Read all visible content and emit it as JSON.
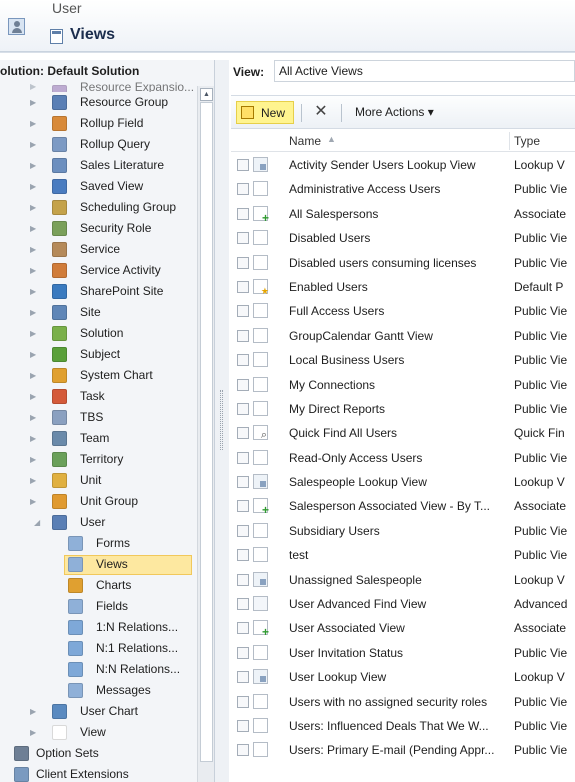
{
  "header": {
    "subtitle": "User",
    "title": "Views"
  },
  "left_panel": {
    "solution_label": "olution: Default Solution",
    "tree": [
      {
        "label": "Resource Expansio...",
        "icon": "resource-expansion-icon",
        "color": "#9a7bb8"
      },
      {
        "label": "Resource Group",
        "icon": "resource-group-icon",
        "color": "#5a7fb5"
      },
      {
        "label": "Rollup Field",
        "icon": "rollup-field-icon",
        "color": "#d88a3a"
      },
      {
        "label": "Rollup Query",
        "icon": "rollup-query-icon",
        "color": "#7c9ac4"
      },
      {
        "label": "Sales Literature",
        "icon": "sales-literature-icon",
        "color": "#6c8fbf"
      },
      {
        "label": "Saved View",
        "icon": "saved-view-icon",
        "color": "#4a7cc0"
      },
      {
        "label": "Scheduling Group",
        "icon": "scheduling-group-icon",
        "color": "#c4a24a"
      },
      {
        "label": "Security Role",
        "icon": "security-role-icon",
        "color": "#7aa05a"
      },
      {
        "label": "Service",
        "icon": "service-icon",
        "color": "#b58a5a"
      },
      {
        "label": "Service Activity",
        "icon": "service-activity-icon",
        "color": "#d07c3a"
      },
      {
        "label": "SharePoint Site",
        "icon": "sharepoint-site-icon",
        "color": "#3a7abf"
      },
      {
        "label": "Site",
        "icon": "site-icon",
        "color": "#5f86b7"
      },
      {
        "label": "Solution",
        "icon": "solution-icon",
        "color": "#7ab04a"
      },
      {
        "label": "Subject",
        "icon": "subject-icon",
        "color": "#5aa03a"
      },
      {
        "label": "System Chart",
        "icon": "system-chart-icon",
        "color": "#e0a030"
      },
      {
        "label": "Task",
        "icon": "task-icon",
        "color": "#d45a3a"
      },
      {
        "label": "TBS",
        "icon": "tbs-icon",
        "color": "#8aa0c0"
      },
      {
        "label": "Team",
        "icon": "team-icon",
        "color": "#6a8aaa"
      },
      {
        "label": "Territory",
        "icon": "territory-icon",
        "color": "#6aa05a"
      },
      {
        "label": "Unit",
        "icon": "unit-icon",
        "color": "#e0b040"
      },
      {
        "label": "Unit Group",
        "icon": "unit-group-icon",
        "color": "#e09a30"
      }
    ],
    "user_node": {
      "label": "User",
      "icon": "user-icon",
      "color": "#5a7fb5"
    },
    "user_children": [
      {
        "label": "Forms",
        "icon": "forms-icon",
        "color": "#8fb0d8",
        "selected": false
      },
      {
        "label": "Views",
        "icon": "views-icon",
        "color": "#8fb0d8",
        "selected": true
      },
      {
        "label": "Charts",
        "icon": "charts-icon",
        "color": "#e0a030",
        "selected": false
      },
      {
        "label": "Fields",
        "icon": "fields-icon",
        "color": "#8fb0d8",
        "selected": false
      },
      {
        "label": "1:N Relations...",
        "icon": "one-to-many-icon",
        "color": "#7ea8d8",
        "selected": false
      },
      {
        "label": "N:1 Relations...",
        "icon": "many-to-one-icon",
        "color": "#7ea8d8",
        "selected": false
      },
      {
        "label": "N:N Relations...",
        "icon": "many-to-many-icon",
        "color": "#7ea8d8",
        "selected": false
      },
      {
        "label": "Messages",
        "icon": "messages-icon",
        "color": "#8fb0d8",
        "selected": false
      }
    ],
    "after_user": [
      {
        "label": "User Chart",
        "icon": "user-chart-icon",
        "color": "#5a8ac0"
      },
      {
        "label": "View",
        "icon": "view-icon",
        "color": "#ffffff"
      }
    ],
    "bottom_items": [
      {
        "label": "Option Sets",
        "icon": "option-sets-icon",
        "color": "#6e7f95"
      },
      {
        "label": "Client Extensions",
        "icon": "client-extensions-icon",
        "color": "#7a9ac0"
      }
    ]
  },
  "view_selector": {
    "label": "View:",
    "value": "All Active Views"
  },
  "toolbar": {
    "new_label": "New",
    "delete_glyph": "✕",
    "more_actions_label": "More Actions ▾"
  },
  "grid": {
    "columns": {
      "name": "Name",
      "type": "Type"
    },
    "rows": [
      {
        "name": "Activity Sender Users Lookup View",
        "type": "Lookup V",
        "icon": "lookup"
      },
      {
        "name": "Administrative Access Users",
        "type": "Public Vie",
        "icon": "public"
      },
      {
        "name": "All Salespersons",
        "type": "Associate",
        "icon": "assoc"
      },
      {
        "name": "Disabled Users",
        "type": "Public Vie",
        "icon": "public"
      },
      {
        "name": "Disabled users consuming licenses",
        "type": "Public Vie",
        "icon": "public"
      },
      {
        "name": "Enabled Users",
        "type": "Default P",
        "icon": "deflt"
      },
      {
        "name": "Full Access Users",
        "type": "Public Vie",
        "icon": "public"
      },
      {
        "name": "GroupCalendar Gantt View",
        "type": "Public Vie",
        "icon": "public"
      },
      {
        "name": "Local Business Users",
        "type": "Public Vie",
        "icon": "public"
      },
      {
        "name": "My Connections",
        "type": "Public Vie",
        "icon": "public"
      },
      {
        "name": "My Direct Reports",
        "type": "Public Vie",
        "icon": "public"
      },
      {
        "name": "Quick Find All Users",
        "type": "Quick Fin",
        "icon": "quick"
      },
      {
        "name": "Read-Only Access Users",
        "type": "Public Vie",
        "icon": "public"
      },
      {
        "name": "Salespeople Lookup View",
        "type": "Lookup V",
        "icon": "lookup"
      },
      {
        "name": "Salesperson Associated View - By T...",
        "type": "Associate",
        "icon": "assoc"
      },
      {
        "name": "Subsidiary Users",
        "type": "Public Vie",
        "icon": "public"
      },
      {
        "name": "test",
        "type": "Public Vie",
        "icon": "public"
      },
      {
        "name": "Unassigned Salespeople",
        "type": "Lookup V",
        "icon": "lookup"
      },
      {
        "name": "User Advanced Find View",
        "type": "Advanced",
        "icon": "adv"
      },
      {
        "name": "User Associated View",
        "type": "Associate",
        "icon": "assoc"
      },
      {
        "name": "User Invitation Status",
        "type": "Public Vie",
        "icon": "public"
      },
      {
        "name": "User Lookup View",
        "type": "Lookup V",
        "icon": "lookup"
      },
      {
        "name": "Users with no assigned security roles",
        "type": "Public Vie",
        "icon": "public"
      },
      {
        "name": "Users: Influenced Deals That We W...",
        "type": "Public Vie",
        "icon": "public"
      },
      {
        "name": "Users: Primary E-mail (Pending Appr...",
        "type": "Public Vie",
        "icon": "public"
      }
    ]
  }
}
